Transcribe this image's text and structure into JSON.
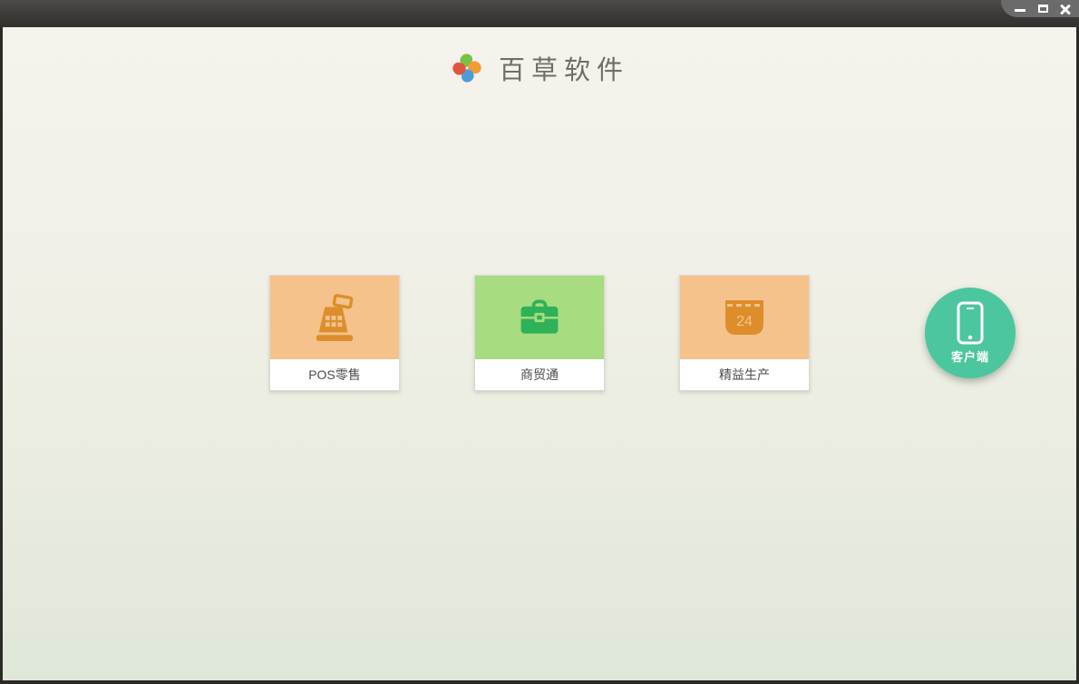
{
  "window": {
    "titlebar": {
      "controls": [
        {
          "name": "minimize",
          "icon": "minimize-icon"
        },
        {
          "name": "maximize",
          "icon": "maximize-icon"
        },
        {
          "name": "close",
          "icon": "close-icon"
        }
      ]
    }
  },
  "header": {
    "title": "百草软件",
    "logo": "pinwheel-logo",
    "logo_colors": {
      "top": "#7bc143",
      "right": "#f49b33",
      "bottom": "#4d9ddb",
      "left": "#e2543e"
    }
  },
  "apps": [
    {
      "label": "POS零售",
      "icon": "cash-register-icon",
      "tile_color": "#f5c28c",
      "icon_color": "#dd8e2b"
    },
    {
      "label": "商贸通",
      "icon": "briefcase-icon",
      "tile_color": "#a7dc81",
      "icon_color": "#2fb158"
    },
    {
      "label": "精益生产",
      "icon": "calendar-icon",
      "tile_color": "#f5c28c",
      "icon_color": "#dd8e2b",
      "icon_text": "24"
    }
  ],
  "client": {
    "label": "客户端",
    "icon": "smartphone-icon",
    "color": "#4cc69e"
  },
  "colors": {
    "titlebar_top": "#4e4c49",
    "titlebar_bottom": "#343230",
    "titlebar_tab": "#6b6b6b",
    "window_border": "#2b2a27",
    "bg_top": "#f5f3ec",
    "bg_bottom": "#dfe7d8",
    "card_label_text": "#4c4c4c",
    "title_text": "#6f6e67"
  }
}
